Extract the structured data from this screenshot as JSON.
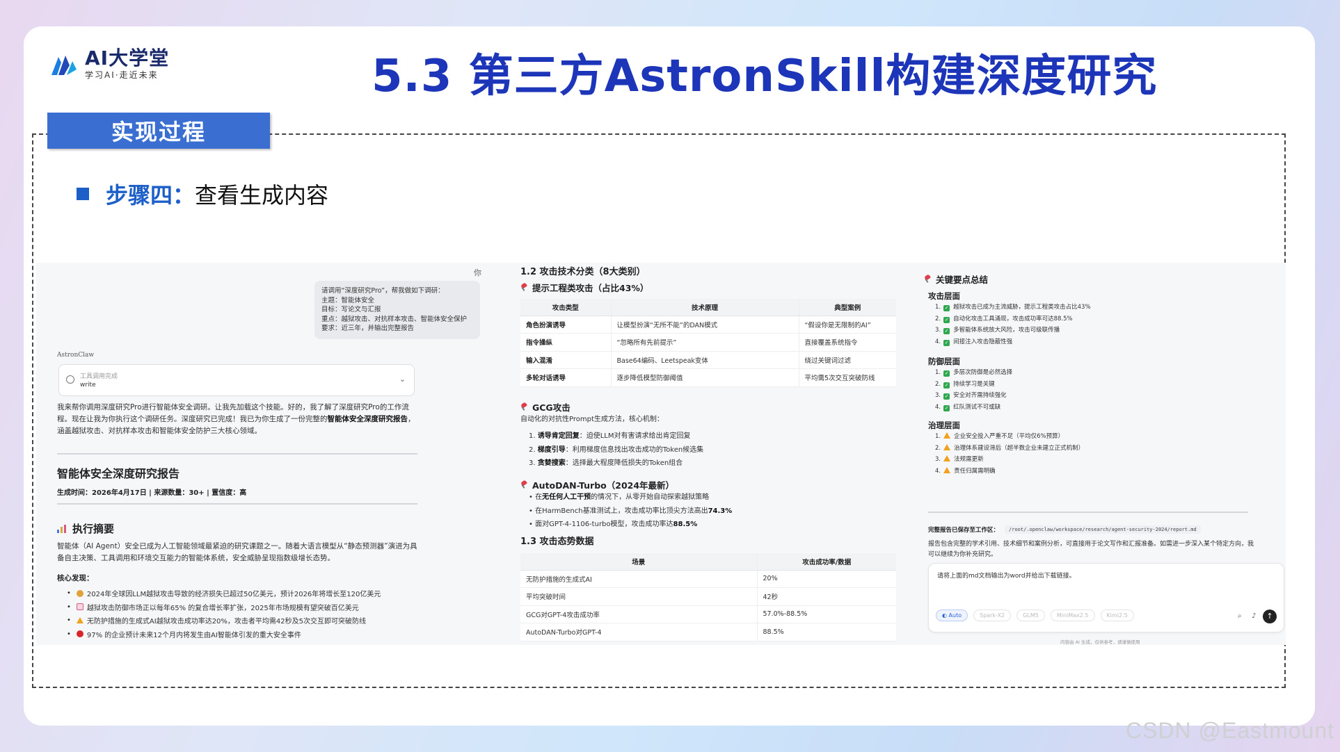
{
  "logo": {
    "title": "AI大学堂",
    "subtitle": "学习AI·走近未来"
  },
  "main_title": "5.3 第三方AstronSkill构建深度研究",
  "section_label": "实现过程",
  "step": {
    "label": "步骤四：",
    "text": "查看生成内容"
  },
  "left": {
    "you_label": "你",
    "bubble": [
      "请调用“深度研究Pro”，帮我做如下调研：",
      "主题：智能体安全",
      "目标：写论文与汇报",
      "重点：越狱攻击、对抗样本攻击、智能体安全保护",
      "要求：近三年，并输出完整报告"
    ],
    "assistant_name": "AstronClaw",
    "tool_status": "工具调用完成",
    "tool_name": "write",
    "para_pre": "我来帮你调用深度研究Pro进行智能体安全调研。让我先加载这个技能。好的，我了解了深度研究Pro的工作流程。现在让我为你执行这个调研任务。深度研究已完成！我已为你生成了一份完整的",
    "para_bold": "智能体安全深度研究报告",
    "para_post": "，涵盖越狱攻击、对抗样本攻击和智能体安全防护三大核心领域。",
    "report_title": "智能体安全深度研究报告",
    "report_meta": "生成时间：2026年4月17日 | 来源数量：30+ | 置信度：高",
    "exec_title": "执行摘要",
    "exec_para": "智能体（AI Agent）安全已成为人工智能领域最紧迫的研究课题之一。随着大语言模型从“静态预测器”演进为具备自主决策、工具调用和环境交互能力的智能体系统，安全威胁呈现指数级增长态势。",
    "core_label": "核心发现：",
    "findings": [
      {
        "icon": "money-bag-icon",
        "color": "#e0a23a",
        "text": "2024年全球因LLM越狱攻击导致的经济损失已超过50亿美元，预计2026年将增长至120亿美元"
      },
      {
        "icon": "chart-up-icon",
        "color": "#d65a7a",
        "text": "越狱攻击防御市场正以每年65% 的复合增长率扩张，2025年市场规模有望突破百亿美元"
      },
      {
        "icon": "warning-icon",
        "color": "#f2a01d",
        "text": "无防护措施的生成式AI越狱攻击成功率达20%，攻击者平均需42秒及5次交互即可突破防线"
      },
      {
        "icon": "red-circle-icon",
        "color": "#d9262b",
        "text": "97% 的企业预计未来12个月内将发生由AI智能体引发的重大安全事件"
      }
    ]
  },
  "middle": {
    "h_taxonomy": "1.2 攻击技术分类（8大类别）",
    "h_prompt": "提示工程类攻击（占比43%）",
    "attack_table": {
      "headers": [
        "攻击类型",
        "技术原理",
        "典型案例"
      ],
      "rows": [
        [
          "角色扮演诱导",
          "让模型扮演“无所不能”的DAN模式",
          "“假设你是无限制的AI”"
        ],
        [
          "指令操纵",
          "“忽略所有先前提示”",
          "直接覆盖系统指令"
        ],
        [
          "输入混淆",
          "Base64编码、Leetspeak变体",
          "绕过关键词过滤"
        ],
        [
          "多轮对话诱导",
          "逐步降低模型防御阈值",
          "平均需5次交互突破防线"
        ]
      ]
    },
    "h_gcg": "GCG攻击",
    "gcg_intro": "自动化的对抗性Prompt生成方法，核心机制：",
    "gcg_items": [
      {
        "k": "诱导肯定回复",
        "v": "：迫使LLM对有害请求给出肯定回复"
      },
      {
        "k": "梯度引导",
        "v": "：利用梯度信息找出攻击成功的Token候选集"
      },
      {
        "k": "贪婪搜索",
        "v": "：选择最大程度降低损失的Token组合"
      }
    ],
    "h_autodan": "AutoDAN-Turbo（2024年最新）",
    "autodan_items": [
      {
        "pre": "在",
        "b": "无任何人工干预",
        "post": "的情况下，从零开始自动探索越狱策略"
      },
      {
        "pre": "在HarmBench基准测试上，攻击成功率比顶尖方法高出",
        "b": "74.3%",
        "post": ""
      },
      {
        "pre": "面对GPT-4-1106-turbo模型，攻击成功率达",
        "b": "88.5%",
        "post": ""
      }
    ],
    "h_stats": "1.3 攻击态势数据",
    "stats_table": {
      "headers": [
        "场景",
        "攻击成功率/数据"
      ],
      "rows": [
        [
          "无防护措施的生成式AI",
          "20%"
        ],
        [
          "平均突破时间",
          "42秒"
        ],
        [
          "GCG对GPT-4攻击成功率",
          "57.0%-88.5%"
        ],
        [
          "AutoDAN-Turbo对GPT-4",
          "88.5%"
        ]
      ]
    }
  },
  "right": {
    "heading": "关键要点总结",
    "attack_layer": "攻击层面",
    "attack_items": [
      "越狱攻击已成为主流威胁，提示工程类攻击占比43%",
      "自动化攻击工具涌现，攻击成功率可达88.5%",
      "多智能体系统放大风险，攻击可级联传播",
      "间接注入攻击隐蔽性强"
    ],
    "defense_layer": "防御层面",
    "defense_items": [
      "多层次防御是必然选择",
      "持续学习是关键",
      "安全对齐需持续强化",
      "红队测试不可或缺"
    ],
    "gov_layer": "治理层面",
    "gov_items": [
      "企业安全投入严重不足（平均仅6%预算）",
      "治理体系建设滞后（超半数企业未建立正式机制）",
      "法规需更新",
      "责任归属需明确"
    ],
    "save_label": "完整报告已保存至工作区：",
    "save_path": "/root/.openclaw/workspace/research/agent-security-2024/report.md",
    "save_para": "报告包含完整的学术引用、技术细节和案例分析，可直接用于论文写作和汇报准备。如需进一步深入某个特定方向，我可以继续为你补充研究。",
    "chat_input": "请将上面的md文档输出为word并给出下载链接。",
    "models": [
      "Auto",
      "Spark-X2",
      "GLM5",
      "MiniMax2.5",
      "Kimi2.5"
    ],
    "disclaimer": "内容由 AI 生成，仅供参考，请谨慎使用"
  },
  "watermark": "CSDN @Eastmount",
  "colors": {
    "title": "#1d35b8",
    "section": "#3a6fd1",
    "step": "#1d5fc9"
  }
}
